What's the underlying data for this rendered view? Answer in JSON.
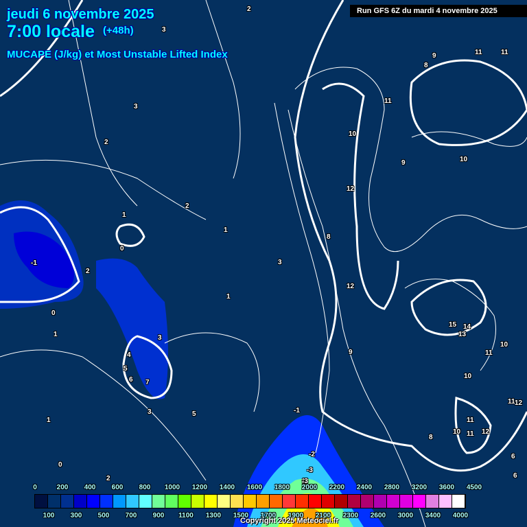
{
  "header": {
    "date": "jeudi 6 novembre 2025",
    "time": "7:00 locale",
    "lead": "(+48h)",
    "parameter": "MUCAPE (J/kg) et Most Unstable Lifted Index",
    "run": "Run GFS 6Z du mardi 4 novembre 2025"
  },
  "contour_labels": [
    "-1",
    "0",
    "1",
    "2",
    "3",
    "2",
    "1",
    "0",
    "1",
    "2",
    "3",
    "4",
    "5",
    "6",
    "7",
    "3",
    "2",
    "1",
    "0",
    "-1",
    "-2",
    "-3",
    "1",
    "2",
    "3",
    "5",
    "8",
    "9",
    "11",
    "12",
    "10",
    "11",
    "9",
    "8",
    "11",
    "12",
    "10",
    "14",
    "13",
    "15",
    "11",
    "10",
    "11",
    "12",
    "6",
    "8",
    "-3",
    "2",
    "3",
    "1",
    "9",
    "10",
    "11",
    "12",
    "11",
    "10",
    "6"
  ],
  "colorbar": {
    "colors": [
      "#001040",
      "#00306a",
      "#003090",
      "#0000c8",
      "#0000ff",
      "#0030ff",
      "#0098ff",
      "#30c8ff",
      "#60ffff",
      "#70ff98",
      "#60ff60",
      "#60ff00",
      "#c8ff00",
      "#ffff00",
      "#ffff80",
      "#ffe050",
      "#ffc800",
      "#ffa000",
      "#ff6800",
      "#ff3838",
      "#ff3000",
      "#ff0000",
      "#e00000",
      "#b00000",
      "#b00040",
      "#b00070",
      "#b000b0",
      "#d000d0",
      "#e000e0",
      "#ff00ff",
      "#e080e0",
      "#ffc0ff",
      "#ffffff"
    ],
    "top_labels": [
      "0",
      "200",
      "400",
      "600",
      "800",
      "1000",
      "1200",
      "1400",
      "1600",
      "1800",
      "2000",
      "2200",
      "2400",
      "2800",
      "3200",
      "3600",
      "4500"
    ],
    "bottom_labels": [
      "100",
      "300",
      "500",
      "700",
      "900",
      "1100",
      "1300",
      "1500",
      "1700",
      "1900",
      "2100",
      "2300",
      "2600",
      "3000",
      "3400",
      "4000"
    ]
  },
  "copyright": "Copyright 2025 Meteociel.fr"
}
